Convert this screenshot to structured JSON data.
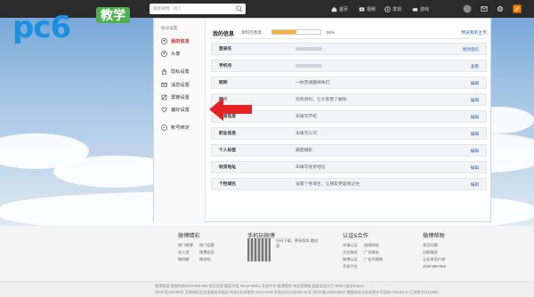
{
  "logo": {
    "text": "pc6",
    "badge": "教学"
  },
  "topbar": {
    "search_placeholder": "搜索微博、找人",
    "nav": [
      {
        "label": "首页",
        "icon": "home-icon"
      },
      {
        "label": "视频",
        "icon": "video-icon"
      },
      {
        "label": "发现",
        "icon": "discover-icon"
      },
      {
        "label": "游戏",
        "icon": "game-icon"
      }
    ]
  },
  "sidebar": {
    "title": "帐号设置",
    "items": [
      {
        "label": "我的信息",
        "icon": "user-icon",
        "active": true
      },
      {
        "label": "头像",
        "icon": "avatar-icon",
        "active": false
      },
      {
        "label": "隐私设置",
        "icon": "lock-icon",
        "active": false
      },
      {
        "label": "消息设置",
        "icon": "message-icon",
        "active": false
      },
      {
        "label": "屏蔽设置",
        "icon": "block-icon",
        "active": false
      },
      {
        "label": "偏好设置",
        "icon": "preference-icon",
        "active": false
      },
      {
        "label": "帐号绑定",
        "icon": "link-icon",
        "active": false
      }
    ]
  },
  "main": {
    "title": "我的信息",
    "progress_label": "资料完善度",
    "progress": 0.5,
    "progress_text": "50%",
    "view_link": "预览我的主页",
    "rows": [
      {
        "label": "登录名",
        "value": "",
        "action": "修改密码"
      },
      {
        "label": "手机号",
        "value": "",
        "action": "查看"
      },
      {
        "label": "昵称",
        "value": "一枚普通酷咪咪们",
        "action": "编辑"
      },
      {
        "label": "简介",
        "value": "完善资料，让大家更了解你",
        "action": "编辑"
      },
      {
        "label": "教育信息",
        "value": "未填写学校",
        "action": "编辑"
      },
      {
        "label": "职业信息",
        "value": "未填写公司",
        "action": "编辑"
      },
      {
        "label": "个人标签",
        "value": "美图摄影",
        "action": "编辑"
      },
      {
        "label": "收货地址",
        "value": "未填写收货地址",
        "action": "编辑"
      },
      {
        "label": "个性域名",
        "value": "设置个性域名，让朋友更容易记住",
        "action": "编辑"
      }
    ]
  },
  "footer": {
    "cols": [
      {
        "title": "微博精彩",
        "links": [
          "热门微博",
          "热门话题",
          "名人堂",
          "微博会员",
          "微明星",
          "微游戏"
        ]
      },
      {
        "title": "认证&合作",
        "links": [
          "申请认证",
          "链接网站",
          "企业服务",
          "广告服务",
          "微博认证",
          "广告代理商",
          "开放平台"
        ]
      },
      {
        "title": "微博帮助",
        "links": [
          "常见问题",
          "自助服务",
          "企业本用户线",
          "4000-960-960"
        ]
      }
    ],
    "mobile": {
      "title": "手机玩微博",
      "qr_text": "扫码下载，更多版本 戳这里"
    },
    "line1": "微博客服  客服热线4000-960-960  常见反馈  舞蹈举报  About Weibo  开放平台  微博营销  来信招聘微  超级非进大厅  DMCA投诉Report",
    "line2": "京ICP证100780号  互联网药品信息服务资格证书(京)-非经营性-2013-0105  京网文[2011]0391-11号  京ICP备12002058号  增值电信业务经营许可证B2-20140447  乙测资字1111000"
  }
}
